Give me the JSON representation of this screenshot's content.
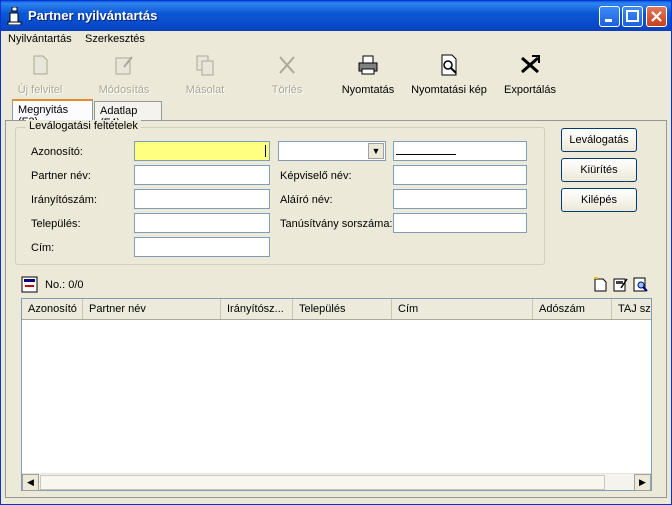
{
  "window": {
    "title": "Partner nyilvántartás"
  },
  "menu": {
    "items": [
      "Nyilvántartás",
      "Szerkesztés"
    ]
  },
  "toolbar": {
    "new": "Új felvitel",
    "modify": "Módosítás",
    "copy": "Másolat",
    "delete": "Törlés",
    "print": "Nyomtatás",
    "print_preview": "Nyomtatási kép",
    "export": "Exportálás"
  },
  "tabs": {
    "filter": "Megnyitás (F3)",
    "datasheet": "Adatlap (F4)"
  },
  "filter": {
    "group_title": "Leválogatási feltételek",
    "labels": {
      "id": "Azonosító:",
      "partner_name": "Partner név:",
      "zip": "Irányítószám:",
      "city": "Település:",
      "address": "Cím:",
      "representative": "Képviselő név:",
      "signer": "Aláíró név:",
      "certificate": "Tanúsítvány sorszáma:"
    }
  },
  "buttons": {
    "filter": "Leválogatás",
    "clear": "Kiürítés",
    "exit": "Kilépés"
  },
  "list": {
    "count": "No.: 0/0",
    "columns": [
      "Azonosító",
      "Partner név",
      "Irányítósz...",
      "Település",
      "Cím",
      "Adószám",
      "TAJ sz"
    ]
  },
  "colors": {
    "title_bar": "#0a58d6",
    "highlight_field": "#ffff80",
    "tab_accent": "#e68b2c"
  }
}
